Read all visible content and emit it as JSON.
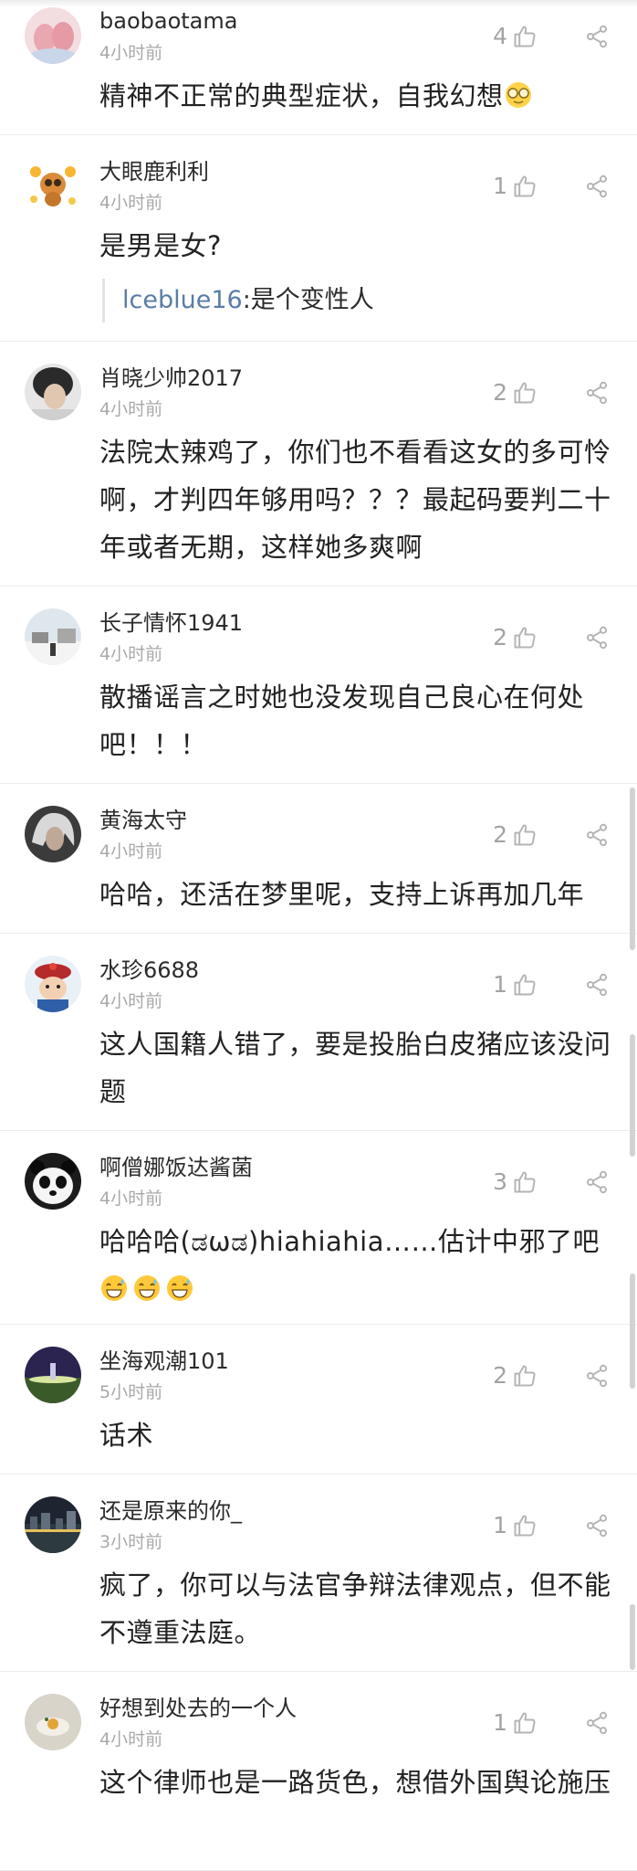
{
  "comments": [
    {
      "user": "baobaotama",
      "time": "4小时前",
      "likes": "4",
      "text": "精神不正常的典型症状，自我幻想",
      "avatar_icon": "pink-baby-feet-avatar",
      "trailing_emoji": "glasses-emoji"
    },
    {
      "user": "大眼鹿利利",
      "time": "4小时前",
      "likes": "1",
      "text": "是男是女?",
      "avatar_icon": "cartoon-deer-avatar",
      "reply": {
        "user": "lceblue16",
        "separator": ":",
        "text": "是个变性人"
      }
    },
    {
      "user": "肖晓少帅2017",
      "time": "4小时前",
      "likes": "2",
      "text": "法院太辣鸡了，你们也不看看这女的多可怜啊，才判四年够用吗？？？最起码要判二十年或者无期，这样她多爽啊",
      "avatar_icon": "dark-hair-person-avatar"
    },
    {
      "user": "长子情怀1941",
      "time": "4小时前",
      "likes": "2",
      "text": "散播谣言之时她也没发现自己良心在何处吧！！！",
      "avatar_icon": "snow-landscape-avatar"
    },
    {
      "user": "黄海太守",
      "time": "4小时前",
      "likes": "2",
      "text": "哈哈，还活在梦里呢，支持上诉再加几年",
      "avatar_icon": "silver-hair-character-avatar"
    },
    {
      "user": "水珍6688",
      "time": "4小时前",
      "likes": "1",
      "text": "这人国籍人错了，要是投胎白皮猪应该没问题",
      "avatar_icon": "qing-official-cartoon-avatar"
    },
    {
      "user": "啊僧娜饭达酱菌",
      "time": "4小时前",
      "likes": "3",
      "text": "哈哈哈(ಡωಡ)hiahiahia……估计中邪了吧",
      "avatar_icon": "panda-avatar",
      "emojis": [
        "grin-sweat-emoji",
        "grin-sweat-emoji",
        "grin-sweat-emoji"
      ]
    },
    {
      "user": "坐海观潮101",
      "time": "5小时前",
      "likes": "2",
      "text": "话术",
      "avatar_icon": "night-city-purple-avatar"
    },
    {
      "user": "还是原来的你_",
      "time": "3小时前",
      "likes": "1",
      "text": "疯了，你可以与法官争辩法律观点，但不能不遵重法庭。",
      "avatar_icon": "night-skyline-avatar"
    },
    {
      "user": "好想到处去的一个人",
      "time": "4小时前",
      "likes": "1",
      "text": "这个律师也是一路货色，想借外国舆论施压",
      "avatar_icon": "food-plate-avatar"
    }
  ],
  "icons": {
    "like": "thumbs-up-icon",
    "share": "share-icon"
  },
  "colors": {
    "text": "#222222",
    "muted": "#a9a9a9",
    "reply_name": "#5a7da6",
    "divider": "#ececec"
  }
}
